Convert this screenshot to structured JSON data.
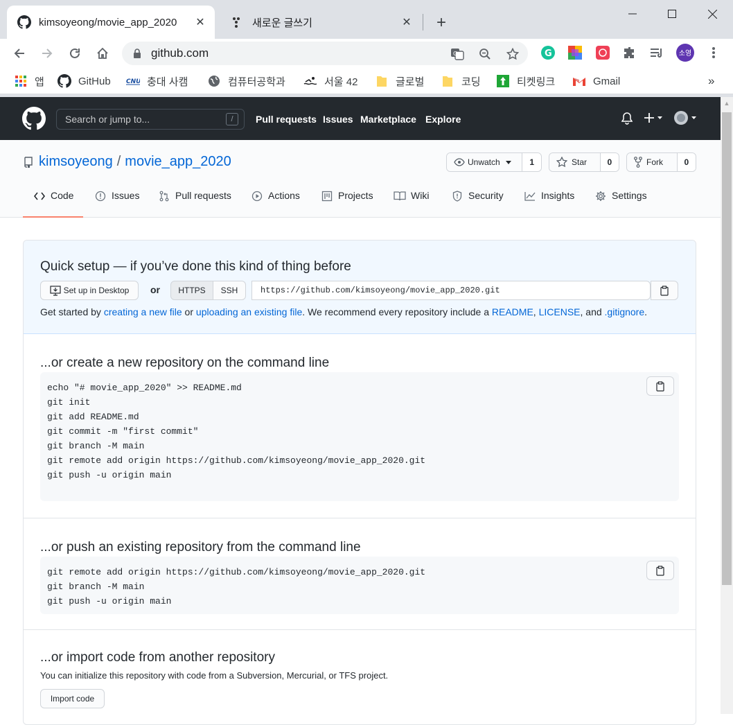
{
  "browser": {
    "tabs": [
      {
        "title": "kimsoyeong/movie_app_2020",
        "favicon": "github-icon",
        "active": true
      },
      {
        "title": "새로운 글쓰기",
        "favicon": "dots-icon",
        "active": false
      }
    ],
    "address": "github.com",
    "profile_initials": "소영",
    "bookmarks": [
      {
        "label": "앱",
        "icon": "apps-grid-icon"
      },
      {
        "label": "GitHub",
        "icon": "github-icon"
      },
      {
        "label": "충대 사캠",
        "icon": "cnu-icon"
      },
      {
        "label": "컴퓨터공학과",
        "icon": "globe-icon"
      },
      {
        "label": "서울 42",
        "icon": "swimmer-icon"
      },
      {
        "label": "글로벌",
        "icon": "folder-icon"
      },
      {
        "label": "코딩",
        "icon": "folder-icon"
      },
      {
        "label": "티켓링크",
        "icon": "ticket-icon"
      },
      {
        "label": "Gmail",
        "icon": "gmail-icon"
      }
    ],
    "bookmarks_more": "»"
  },
  "github": {
    "search_placeholder": "Search or jump to...",
    "search_key": "/",
    "nav": [
      "Pull requests",
      "Issues",
      "Marketplace",
      "Explore"
    ]
  },
  "repo": {
    "owner": "kimsoyeong",
    "separator": "/",
    "name": "movie_app_2020",
    "watch": {
      "label": "Unwatch",
      "count": "1"
    },
    "star": {
      "label": "Star",
      "count": "0"
    },
    "fork": {
      "label": "Fork",
      "count": "0"
    },
    "tabs": [
      {
        "label": "Code",
        "icon": "code-icon",
        "selected": true
      },
      {
        "label": "Issues",
        "icon": "issue-icon"
      },
      {
        "label": "Pull requests",
        "icon": "pull-request-icon"
      },
      {
        "label": "Actions",
        "icon": "play-icon"
      },
      {
        "label": "Projects",
        "icon": "project-icon"
      },
      {
        "label": "Wiki",
        "icon": "book-icon"
      },
      {
        "label": "Security",
        "icon": "shield-icon"
      },
      {
        "label": "Insights",
        "icon": "graph-icon"
      },
      {
        "label": "Settings",
        "icon": "gear-icon"
      }
    ]
  },
  "quick_setup": {
    "title": "Quick setup — if you’ve done this kind of thing before",
    "desktop_button": "Set up in Desktop",
    "or": "or",
    "https": "HTTPS",
    "ssh": "SSH",
    "clone_url": "https://github.com/kimsoyeong/movie_app_2020.git",
    "text_before": "Get started by ",
    "link_create": "creating a new file",
    "text_or": " or ",
    "link_upload": "uploading an existing file",
    "text_mid": ". We recommend every repository include a ",
    "link_readme": "README",
    "comma": ", ",
    "link_license": "LICENSE",
    "text_and": ", and ",
    "link_gitignore": ".gitignore",
    "text_end": "."
  },
  "new_repo": {
    "title": "...or create a new repository on the command line",
    "code": "echo \"# movie_app_2020\" >> README.md\ngit init\ngit add README.md\ngit commit -m \"first commit\"\ngit branch -M main\ngit remote add origin https://github.com/kimsoyeong/movie_app_2020.git\ngit push -u origin main"
  },
  "push_repo": {
    "title": "...or push an existing repository from the command line",
    "code": "git remote add origin https://github.com/kimsoyeong/movie_app_2020.git\ngit branch -M main\ngit push -u origin main"
  },
  "import_repo": {
    "title": "...or import code from another repository",
    "text": "You can initialize this repository with code from a Subversion, Mercurial, or TFS project.",
    "button": "Import code"
  },
  "colors": {
    "header_bg": "#24292e",
    "link": "#0366d6",
    "tab_underline": "#f9826c",
    "quick_bg": "#f1f8ff"
  }
}
